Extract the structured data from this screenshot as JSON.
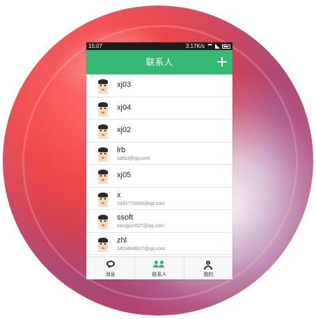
{
  "status_bar": {
    "time": "15:07",
    "network_speed": "3.17K/s"
  },
  "header": {
    "title": "联系人",
    "add_icon": "plus-icon"
  },
  "contacts": [
    {
      "name": "xj03",
      "email": ""
    },
    {
      "name": "xj04",
      "email": ""
    },
    {
      "name": "xj02",
      "email": ""
    },
    {
      "name": "lrb",
      "email": "sdfad@qq.com"
    },
    {
      "name": "xj05",
      "email": ""
    },
    {
      "name": "x",
      "email": "2435775845@qq.com"
    },
    {
      "name": "ssoft",
      "email": "xiongjun627@qq.com"
    },
    {
      "name": "zhl",
      "email": "1453648607@qq.com"
    }
  ],
  "tabs": [
    {
      "label": "消息",
      "icon": "chat-icon",
      "active": false
    },
    {
      "label": "联系人",
      "icon": "contacts-icon",
      "active": true
    },
    {
      "label": "我的",
      "icon": "person-icon",
      "active": false
    }
  ],
  "colors": {
    "primary_green": "#35b872",
    "orb_red": "#f04848"
  }
}
